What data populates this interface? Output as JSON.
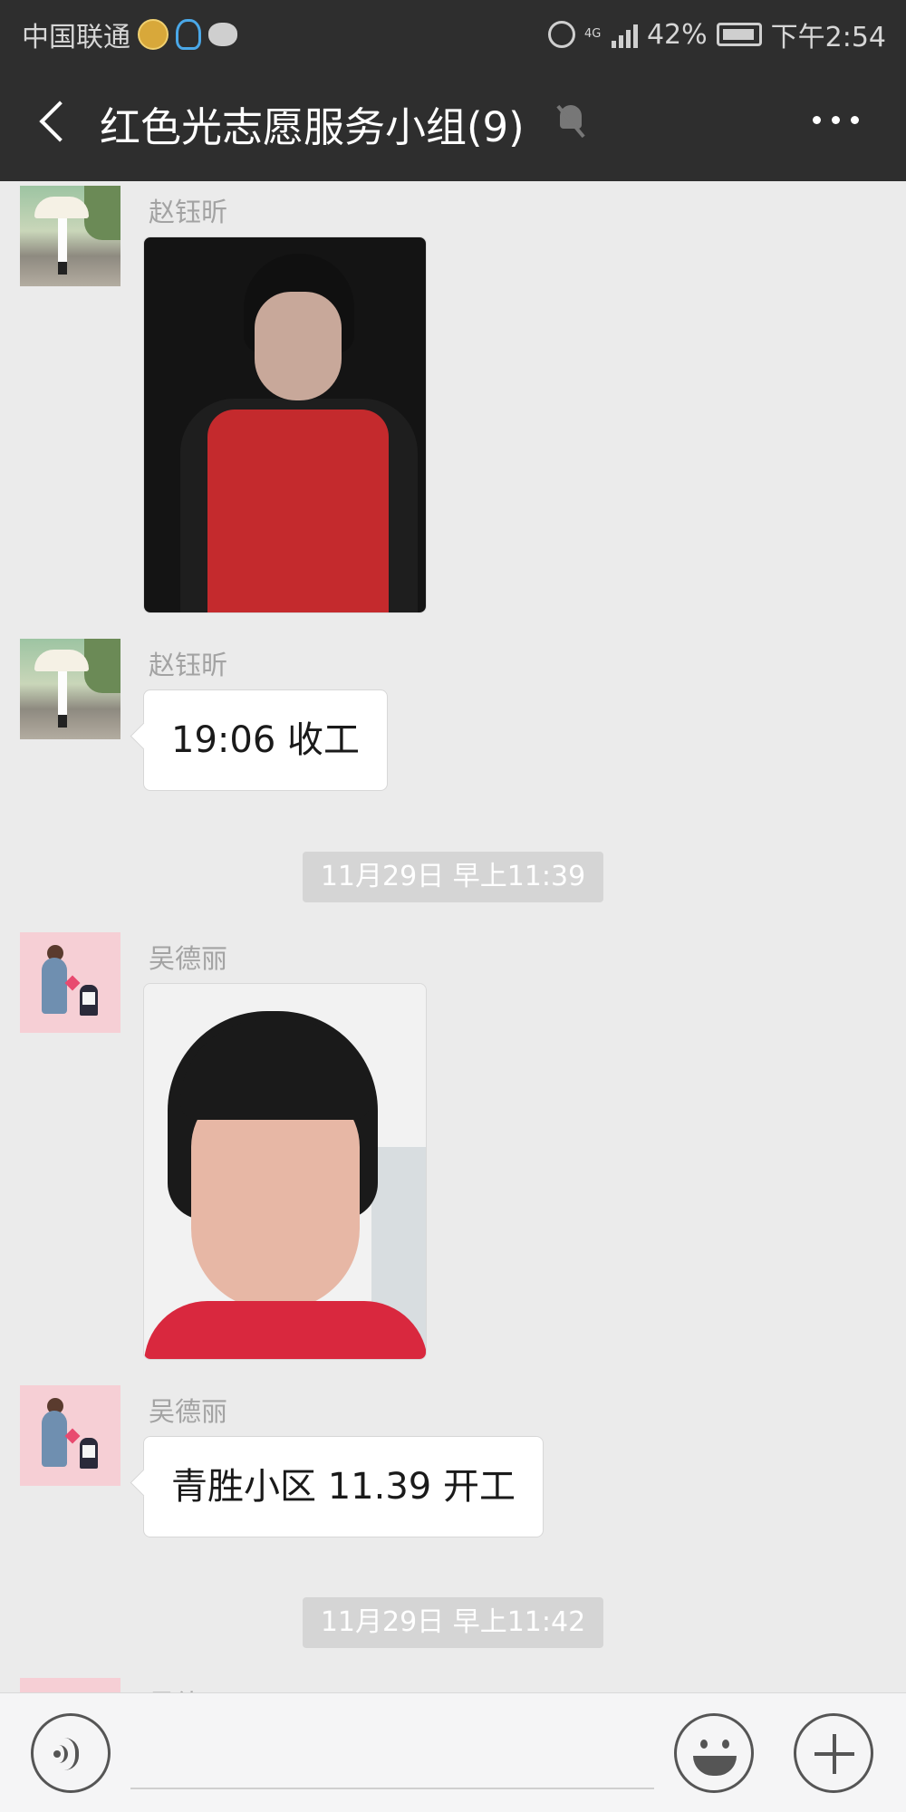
{
  "status_bar": {
    "carrier": "中国联通",
    "network": "4G",
    "battery": "42%",
    "time": "下午2:54"
  },
  "header": {
    "title": "红色光志愿服务小组(9)"
  },
  "messages": [
    {
      "sender": "赵钰昕",
      "type": "image"
    },
    {
      "sender": "赵钰昕",
      "type": "text",
      "text": "19:06 收工"
    },
    {
      "type": "timestamp",
      "text": "11月29日 早上11:39"
    },
    {
      "sender": "吴德丽",
      "type": "image"
    },
    {
      "sender": "吴德丽",
      "type": "text",
      "text": "青胜小区 11.39 开工"
    },
    {
      "type": "timestamp",
      "text": "11月29日 早上11:42"
    },
    {
      "sender": "吴德丽",
      "type": "partial"
    }
  ],
  "icons": {
    "back": "chevron-left-icon",
    "mute": "muted-bell-icon",
    "more": "more-dots-icon",
    "voice": "voice-icon",
    "emoji": "emoji-icon",
    "plus": "plus-icon"
  }
}
